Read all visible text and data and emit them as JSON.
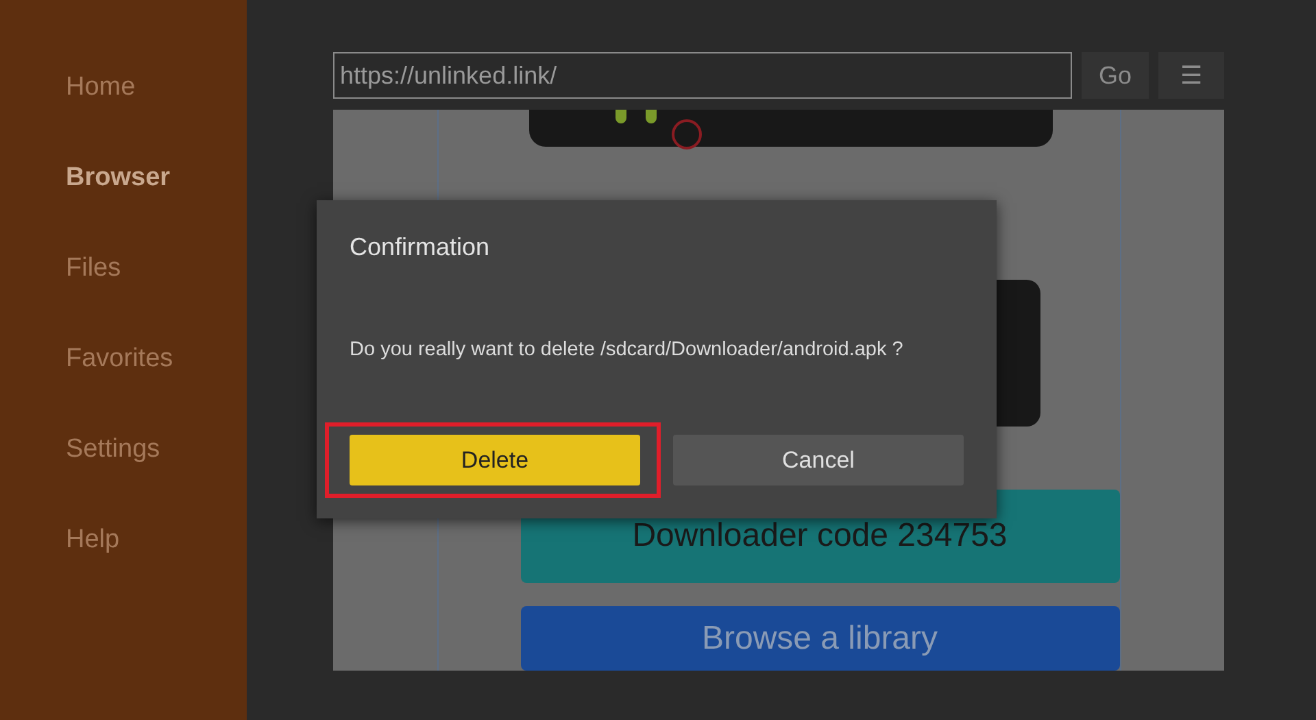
{
  "sidebar": {
    "items": [
      {
        "label": "Home",
        "selected": false
      },
      {
        "label": "Browser",
        "selected": true
      },
      {
        "label": "Files",
        "selected": false
      },
      {
        "label": "Favorites",
        "selected": false
      },
      {
        "label": "Settings",
        "selected": false
      },
      {
        "label": "Help",
        "selected": false
      }
    ]
  },
  "address_bar": {
    "value": "https://unlinked.link/"
  },
  "go_button": {
    "label": "Go"
  },
  "menu_button": {
    "label": "☰"
  },
  "page": {
    "buttons": [
      {
        "label": "Downloader code 234753",
        "kind": "teal"
      },
      {
        "label": "Browse a library",
        "kind": "blue"
      }
    ]
  },
  "dialog": {
    "title": "Confirmation",
    "message": "Do you really want to delete /sdcard/Downloader/android.apk ?",
    "buttons": [
      {
        "label": "Delete",
        "focused": true,
        "annotated": true
      },
      {
        "label": "Cancel",
        "focused": false,
        "annotated": false
      }
    ]
  }
}
